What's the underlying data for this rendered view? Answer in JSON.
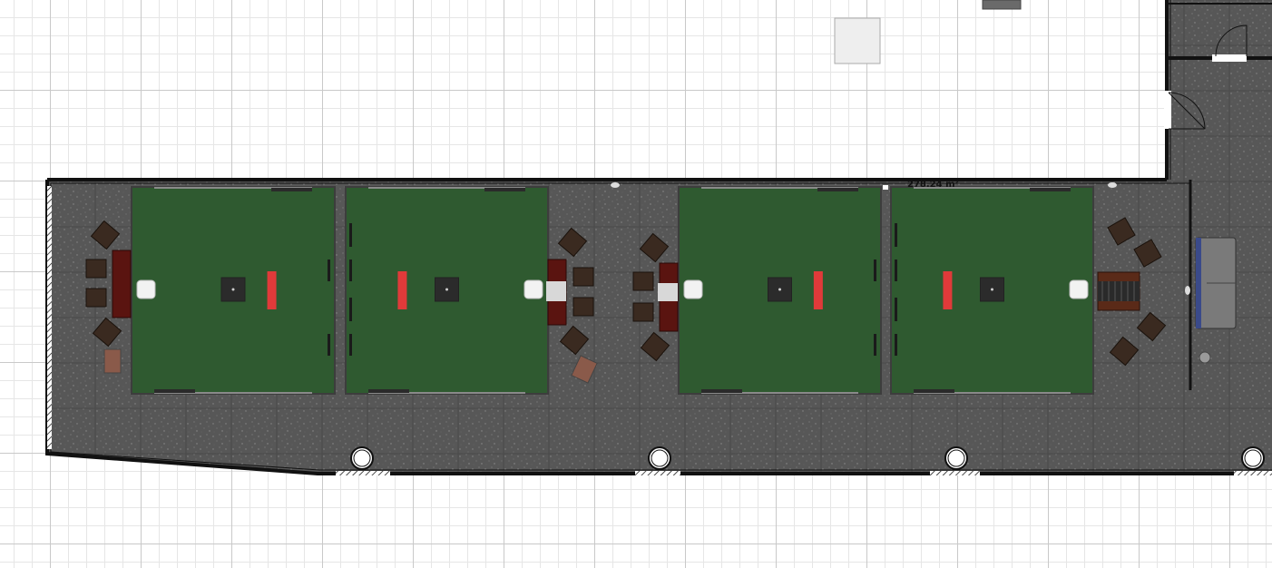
{
  "room": {
    "area_label": "278.24 m²",
    "floor_color": "#575757",
    "wall_color": "#111111"
  },
  "tables": {
    "count": 4,
    "felt_color": "#2f5a30",
    "rail_color": "#3d3d3d",
    "center_marker_color": "#2b2b2b",
    "red_marker_color": "#e03a3a"
  },
  "furniture": {
    "chair_color": "#3a2a20",
    "cabinet_color": "#5a1410",
    "sofa_color": "#7a7a7a",
    "sofa_accent": "#3a4a8a",
    "columns": 4,
    "icons": [
      "chair-icon",
      "cabinet-icon",
      "sofa-icon",
      "door-icon",
      "column-icon",
      "plant-icon",
      "lamp-icon"
    ]
  }
}
